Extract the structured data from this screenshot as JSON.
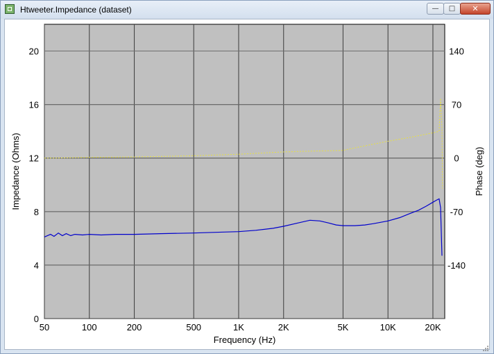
{
  "window": {
    "title": "Htweeter.Impedance (dataset)",
    "minimize_glyph": "—",
    "maximize_glyph": "□",
    "close_glyph": "✕"
  },
  "colors": {
    "plot_bg": "#c0c0c0",
    "grid": "#3a3a3a",
    "impedance": "#0000cc",
    "phase": "#e8e040"
  },
  "chart_data": {
    "type": "line",
    "xlabel": "Frequency (Hz)",
    "ylabel": "Impedance (Ohms)",
    "y2label": "Phase (deg)",
    "xscale": "log",
    "xlim": [
      50,
      24000
    ],
    "ylim": [
      0,
      22
    ],
    "y2lim": [
      -210,
      175
    ],
    "grid": true,
    "x_ticks": [
      {
        "value": 50,
        "label": "50"
      },
      {
        "value": 100,
        "label": "100"
      },
      {
        "value": 200,
        "label": "200"
      },
      {
        "value": 500,
        "label": "500"
      },
      {
        "value": 1000,
        "label": "1K"
      },
      {
        "value": 2000,
        "label": "2K"
      },
      {
        "value": 5000,
        "label": "5K"
      },
      {
        "value": 10000,
        "label": "10K"
      },
      {
        "value": 20000,
        "label": "20K"
      }
    ],
    "y_ticks": [
      {
        "value": 0,
        "label": "0"
      },
      {
        "value": 4,
        "label": "4"
      },
      {
        "value": 8,
        "label": "8"
      },
      {
        "value": 12,
        "label": "12"
      },
      {
        "value": 16,
        "label": "16"
      },
      {
        "value": 20,
        "label": "20"
      }
    ],
    "y2_ticks": [
      {
        "value": 140,
        "label": "140"
      },
      {
        "value": 70,
        "label": "70"
      },
      {
        "value": 0,
        "label": "0"
      },
      {
        "value": -70,
        "label": "-70"
      },
      {
        "value": -140,
        "label": "-140"
      }
    ],
    "series": [
      {
        "axis": "left",
        "color": "#0000cc",
        "style": "solid",
        "points": [
          [
            50,
            6.1
          ],
          [
            55,
            6.3
          ],
          [
            58,
            6.15
          ],
          [
            62,
            6.4
          ],
          [
            66,
            6.2
          ],
          [
            70,
            6.35
          ],
          [
            75,
            6.2
          ],
          [
            80,
            6.3
          ],
          [
            90,
            6.25
          ],
          [
            100,
            6.3
          ],
          [
            120,
            6.25
          ],
          [
            150,
            6.3
          ],
          [
            200,
            6.3
          ],
          [
            300,
            6.35
          ],
          [
            500,
            6.4
          ],
          [
            700,
            6.45
          ],
          [
            1000,
            6.5
          ],
          [
            1300,
            6.6
          ],
          [
            1700,
            6.75
          ],
          [
            2000,
            6.9
          ],
          [
            2500,
            7.15
          ],
          [
            3000,
            7.35
          ],
          [
            3500,
            7.3
          ],
          [
            4000,
            7.15
          ],
          [
            4500,
            7.0
          ],
          [
            5000,
            6.95
          ],
          [
            6000,
            6.95
          ],
          [
            7000,
            7.0
          ],
          [
            8000,
            7.1
          ],
          [
            10000,
            7.3
          ],
          [
            12000,
            7.55
          ],
          [
            14000,
            7.85
          ],
          [
            16000,
            8.1
          ],
          [
            18000,
            8.4
          ],
          [
            20000,
            8.7
          ],
          [
            21500,
            8.9
          ],
          [
            22000,
            8.95
          ],
          [
            22500,
            8.3
          ],
          [
            23000,
            4.7
          ]
        ]
      },
      {
        "axis": "right",
        "color": "#e8e040",
        "style": "dotted",
        "points": [
          [
            50,
            0
          ],
          [
            60,
            0
          ],
          [
            100,
            1
          ],
          [
            200,
            1.5
          ],
          [
            500,
            3
          ],
          [
            1000,
            5
          ],
          [
            2000,
            8
          ],
          [
            3000,
            9
          ],
          [
            5000,
            10
          ],
          [
            7000,
            16
          ],
          [
            10000,
            22
          ],
          [
            14000,
            27
          ],
          [
            20000,
            33
          ],
          [
            22000,
            35
          ],
          [
            22500,
            78
          ],
          [
            23000,
            40
          ],
          [
            23200,
            -40
          ]
        ]
      }
    ]
  }
}
